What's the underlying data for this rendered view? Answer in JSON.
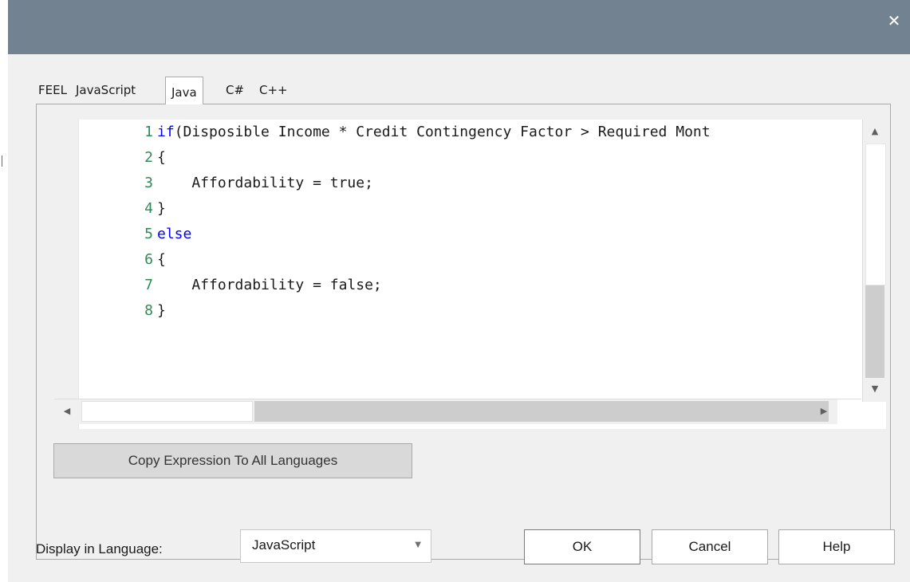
{
  "window": {
    "close_glyph": "✕"
  },
  "tabs": [
    {
      "label": "FEEL",
      "active": false
    },
    {
      "label": "JavaScript",
      "active": false
    },
    {
      "label": "Java",
      "active": true
    },
    {
      "label": "C#",
      "active": false
    },
    {
      "label": "C++",
      "active": false
    }
  ],
  "code": {
    "lines": [
      {
        "n": "1",
        "kw": "if",
        "text": "(Disposible Income * Credit Contingency Factor > Required Mont"
      },
      {
        "n": "2",
        "kw": "",
        "text": "{"
      },
      {
        "n": "3",
        "kw": "",
        "text": "    Affordability = true;"
      },
      {
        "n": "4",
        "kw": "",
        "text": "}"
      },
      {
        "n": "5",
        "kw": "else",
        "text": ""
      },
      {
        "n": "6",
        "kw": "",
        "text": "{"
      },
      {
        "n": "7",
        "kw": "",
        "text": "    Affordability = false;"
      },
      {
        "n": "8",
        "kw": "",
        "text": "}"
      }
    ],
    "keyword_color": "#0000ff",
    "line_number_color": "#2e8b57"
  },
  "scrollbar_arrows": {
    "up": "▲",
    "down": "▼",
    "left": "◀",
    "right": "▶"
  },
  "copy_button": "Copy Expression To All Languages",
  "display_language": {
    "label": "Display in Language:",
    "value": "JavaScript",
    "chevron": "▼"
  },
  "buttons": {
    "ok": "OK",
    "cancel": "Cancel",
    "help": "Help"
  },
  "colors": {
    "titlebar": "#738291",
    "dialog_bg": "#f0f0f0"
  }
}
